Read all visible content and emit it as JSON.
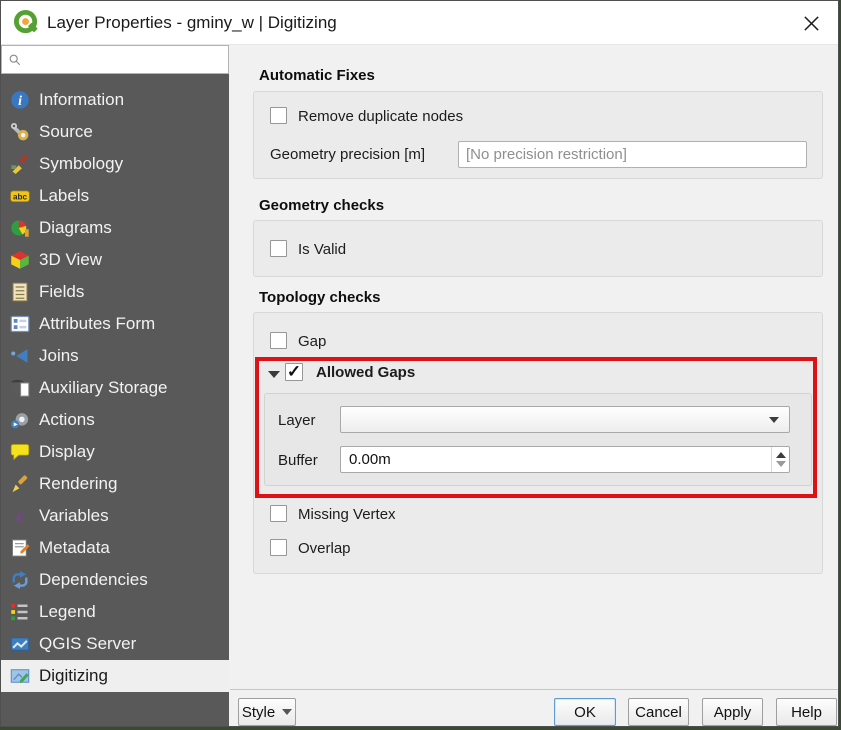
{
  "window": {
    "title": "Layer Properties - gminy_w | Digitizing"
  },
  "sidebar": {
    "search": {
      "placeholder": "",
      "icon": "search-icon"
    },
    "selected_label": "Digitizing",
    "items": [
      {
        "label": "Information",
        "icon": "information-icon"
      },
      {
        "label": "Source",
        "icon": "source-icon"
      },
      {
        "label": "Symbology",
        "icon": "symbology-icon"
      },
      {
        "label": "Labels",
        "icon": "labels-icon"
      },
      {
        "label": "Diagrams",
        "icon": "diagrams-icon"
      },
      {
        "label": "3D View",
        "icon": "3d-view-icon"
      },
      {
        "label": "Fields",
        "icon": "fields-icon"
      },
      {
        "label": "Attributes Form",
        "icon": "attributes-form-icon"
      },
      {
        "label": "Joins",
        "icon": "joins-icon"
      },
      {
        "label": "Auxiliary Storage",
        "icon": "auxiliary-storage-icon"
      },
      {
        "label": "Actions",
        "icon": "actions-icon"
      },
      {
        "label": "Display",
        "icon": "display-icon"
      },
      {
        "label": "Rendering",
        "icon": "rendering-icon"
      },
      {
        "label": "Variables",
        "icon": "variables-icon"
      },
      {
        "label": "Metadata",
        "icon": "metadata-icon"
      },
      {
        "label": "Dependencies",
        "icon": "dependencies-icon"
      },
      {
        "label": "Legend",
        "icon": "legend-icon"
      },
      {
        "label": "QGIS Server",
        "icon": "qgis-server-icon"
      },
      {
        "label": "Digitizing",
        "icon": "digitizing-icon"
      }
    ]
  },
  "main": {
    "automatic_fixes": {
      "title": "Automatic Fixes",
      "remove_duplicate_nodes": "Remove duplicate nodes",
      "precision_label": "Geometry precision  [m]",
      "precision_placeholder": "[No precision restriction]",
      "precision_value": ""
    },
    "geometry_checks": {
      "title": "Geometry checks",
      "is_valid": "Is Valid"
    },
    "topology_checks": {
      "title": "Topology checks",
      "gap": "Gap",
      "allowed_gaps": "Allowed Gaps",
      "allowed_gaps_check": "✓",
      "layer_label": "Layer",
      "layer_value": "",
      "buffer_label": "Buffer",
      "buffer_value": "0.00m",
      "missing_vertex": "Missing Vertex",
      "overlap": "Overlap"
    }
  },
  "footer": {
    "style": "Style",
    "ok": "OK",
    "cancel": "Cancel",
    "apply": "Apply",
    "help": "Help"
  },
  "colors": {
    "annotation_red": "#dd1216",
    "sidebar_bg": "#595959",
    "selected_item_bg": "#efefef",
    "ok_focus_border": "#5e9bd3"
  }
}
